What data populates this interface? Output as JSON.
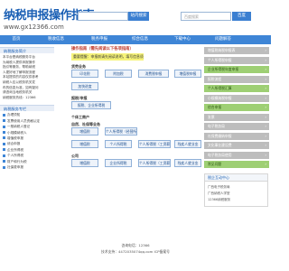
{
  "header": {
    "title": "纳税申报操作指南",
    "url": "www.gx12366.com",
    "search1_placeholder": "",
    "search1_button": "站内搜索",
    "search2_placeholder": "百度搜索",
    "search2_button": "百度"
  },
  "nav": [
    "首页",
    "税收信息",
    "税务申报",
    "综合信息",
    "下载中心",
    "问题解答"
  ],
  "sidebar": {
    "intro_title": "纳税服务简介",
    "intro_lines": [
      "本平台是纳税服务平台",
      "为纳税人提供申报操作",
      "指引等服务，帮助纳税",
      "人更好地了解申报流程",
      "本站提供的内容仅供参考",
      "纳税人应以税务机关发",
      "布的信息为准，如有疑问",
      "请咨询当地税务机关",
      "纳税服务热线：12366"
    ],
    "list_title": "纳税服务专栏",
    "list_items": [
      "办理须知",
      "发票使用人员资格认定",
      "一般纳税人登记",
      "小规模纳税人",
      "增值税申报",
      "综合申报",
      "企业所得税",
      "个人所得税",
      "财产和行为税",
      "社保费申报"
    ]
  },
  "main": {
    "title": "操作指南（需先阅读以下各项指南）",
    "notice": "重要提醒：申报前请先阅读说明，填写信息须真实准确",
    "sections": [
      {
        "title": "货劳业务",
        "rows": [
          [
            "印花税",
            "附加税",
            "消费税申报",
            "增值税申报"
          ],
          [
            "加快进度"
          ]
        ]
      },
      {
        "title": "报税/申报",
        "rows": [
          [
            "报税、企业所得税"
          ]
        ]
      },
      {
        "title": "个体工商户",
        "rows": []
      },
      {
        "title": "自然、社保等业务",
        "rows": [
          [
            "增值税",
            "个人所得税（经营所得）"
          ],
          [
            "增值税",
            "个人所得税",
            "个人所得税（工资薪金）",
            "残疾人就业金"
          ]
        ]
      },
      {
        "title": "公司",
        "rows": [
          [
            "增值税",
            "企业所得税",
            "个人所得税（工资薪金）",
            "残疾人就业金"
          ]
        ]
      }
    ]
  },
  "right": {
    "buttons": [
      {
        "label": "增值税纳税申报表",
        "green": false
      },
      {
        "label": "个人所得税申报",
        "green": false
      },
      {
        "label": "企业所得税年度申报",
        "green": true
      },
      {
        "label": "报税流程",
        "green": false
      },
      {
        "label": "个人所得税汇算",
        "green": true
      },
      {
        "label": "小规模纳税申报",
        "green": false
      },
      {
        "label": "综合申报",
        "green": true
      },
      {
        "label": "发票",
        "green": false
      },
      {
        "label": "电子税务局",
        "green": false
      },
      {
        "label": "社保费缴纳申报",
        "green": false
      },
      {
        "label": "文化事业建设费",
        "green": false
      },
      {
        "label": "电子税务局使用",
        "green": false
      },
      {
        "label": "常见问题",
        "green": true
      }
    ],
    "panel_title": "税企互动中心",
    "panel_items": [
      "广西电子税务局",
      "广西纳税人学堂",
      "12366纳税服务"
    ]
  },
  "footer": {
    "line1": "咨询电话：12366",
    "line2": "技术支持：4472035074qq.com ICP备案号"
  }
}
